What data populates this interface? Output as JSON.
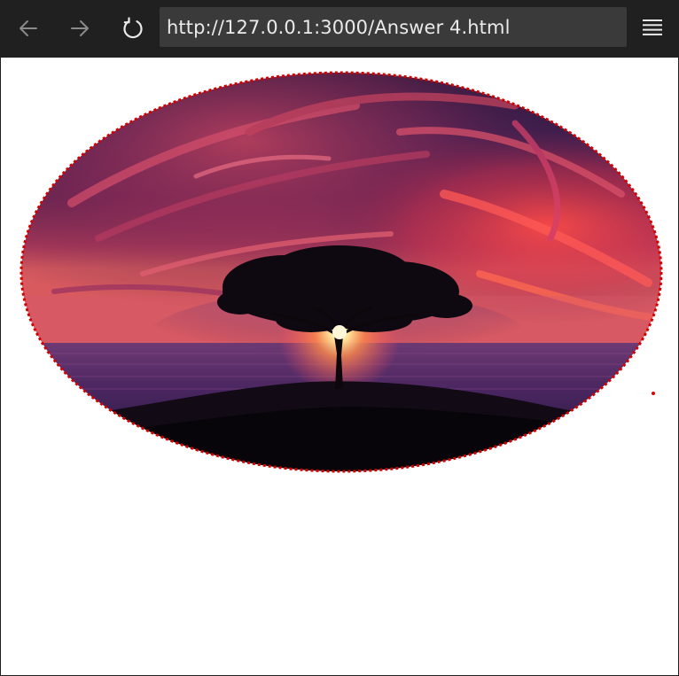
{
  "browser": {
    "url": "http://127.0.0.1:3000/Answer 4.html",
    "back_icon": "arrow-left-icon",
    "forward_icon": "arrow-right-icon",
    "reload_icon": "reload-icon",
    "menu_icon": "hamburger-menu-icon"
  },
  "page": {
    "image_subject": "sunset-tree-over-sea",
    "image_border_style": "dotted",
    "colors": {
      "toolbar": "#202020",
      "address_bg": "#3a3a3a",
      "address_text": "#eaeaea",
      "border": "#e00000",
      "page_bg": "#ffffff"
    }
  }
}
